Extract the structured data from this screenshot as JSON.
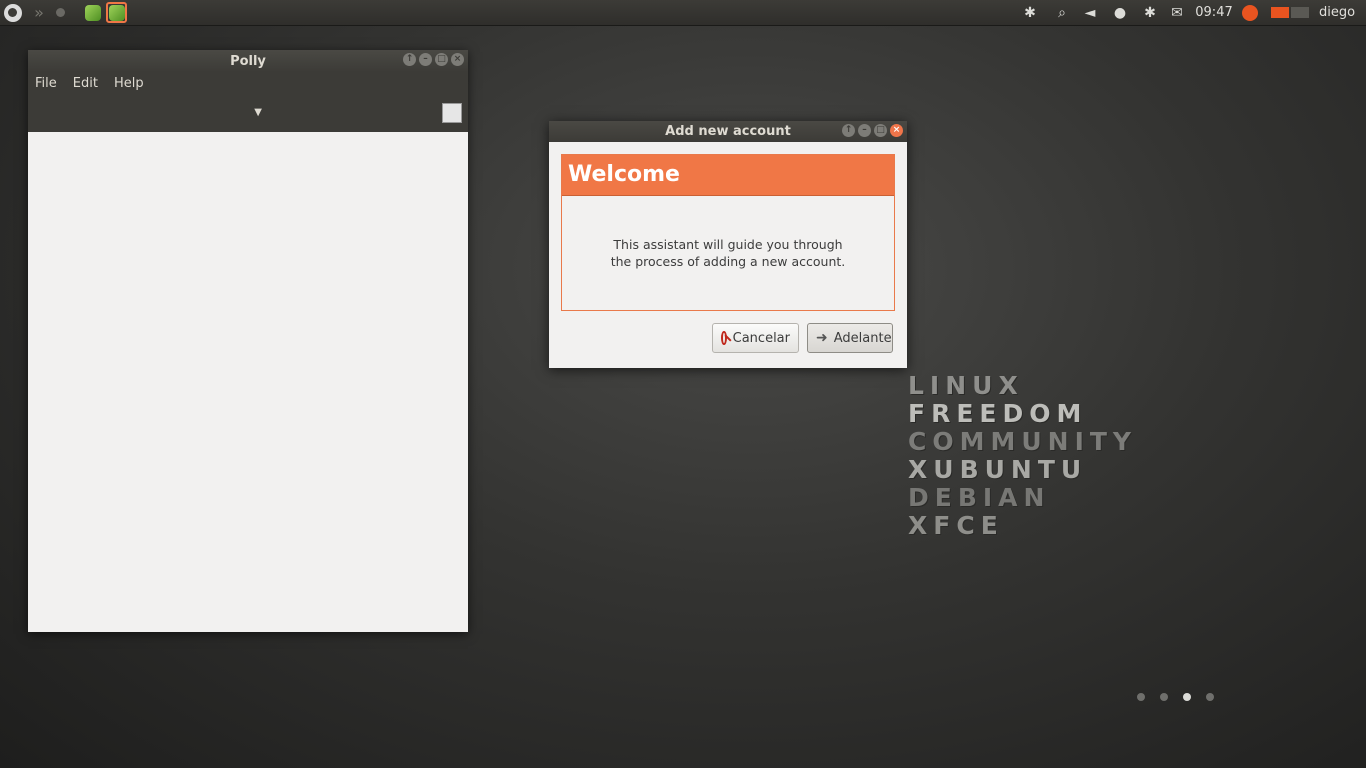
{
  "panel": {
    "clock": "09:47",
    "user": "diego",
    "tray_icons": [
      "bluetooth-icon",
      "search-icon",
      "volume-icon",
      "network-icon",
      "bluetooth-icon",
      "mail-icon"
    ]
  },
  "polly": {
    "title": "Polly",
    "menu": [
      "File",
      "Edit",
      "Help"
    ],
    "dropdown_arrow": "▼"
  },
  "dialog": {
    "title": "Add new account",
    "header": "Welcome",
    "text_line1": "This assistant will guide you through",
    "text_line2": "the process of adding a new account.",
    "cancel_label": "Cancelar",
    "forward_label": "Adelante",
    "accent": "#f07746"
  },
  "wallpaper": {
    "words": [
      "LINUX",
      "FREEDOM",
      "COMMUNITY",
      "XUBUNTU",
      "DEBIAN",
      "XFCE"
    ]
  },
  "workspaces": {
    "count": 4,
    "active": 3
  }
}
